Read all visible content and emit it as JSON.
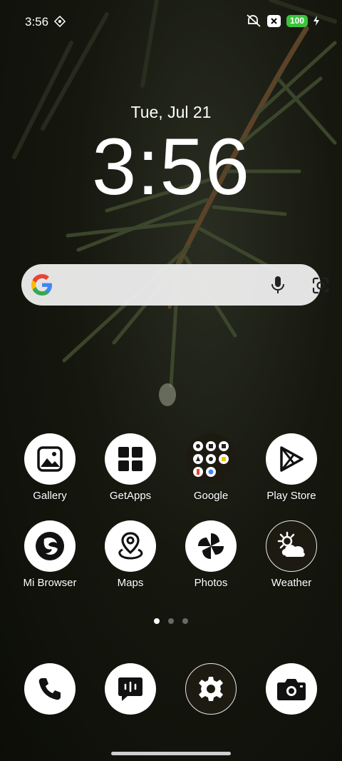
{
  "status": {
    "time": "3:56",
    "battery": "100"
  },
  "lockscreen": {
    "date": "Tue, Jul 21",
    "clock": "3:56"
  },
  "apps": [
    {
      "label": "Gallery",
      "icon": "gallery-icon"
    },
    {
      "label": "GetApps",
      "icon": "getapps-icon"
    },
    {
      "label": "Google",
      "icon": "google-folder-icon"
    },
    {
      "label": "Play Store",
      "icon": "play-store-icon"
    },
    {
      "label": "Mi Browser",
      "icon": "mi-browser-icon"
    },
    {
      "label": "Maps",
      "icon": "maps-icon"
    },
    {
      "label": "Photos",
      "icon": "photos-icon"
    },
    {
      "label": "Weather",
      "icon": "weather-icon"
    }
  ],
  "dock": [
    "phone-icon",
    "messages-icon",
    "settings-icon",
    "camera-icon"
  ],
  "pager": {
    "pages": 3,
    "active": 1
  }
}
